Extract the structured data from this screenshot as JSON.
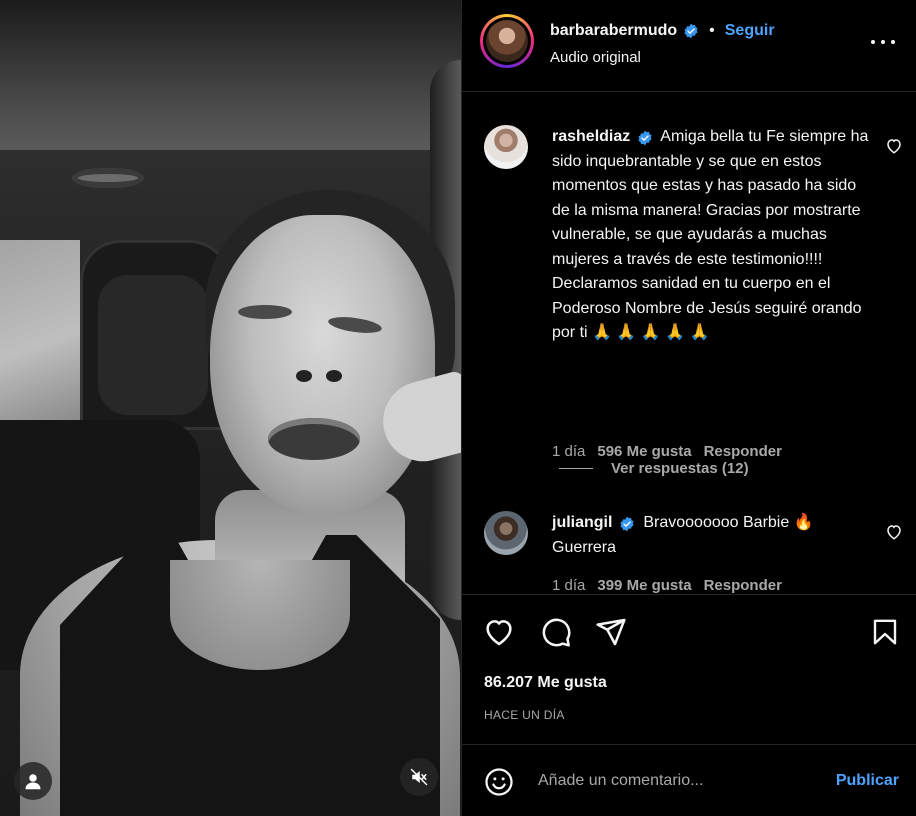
{
  "post": {
    "username": "barbarabermudo",
    "dot": "•",
    "follow_label": "Seguir",
    "subtitle": "Audio original",
    "likes_count": "86.207 Me gusta",
    "time_ago": "HACE UN DÍA",
    "verified": true
  },
  "comments": [
    {
      "username": "rasheldiaz",
      "verified": true,
      "text": "Amiga bella tu Fe siempre ha sido inquebrantable y se que en estos momentos que estas y has pasado ha sido de la misma manera! Gracias por mostrarte vulnerable, se que ayudarás a muchas mujeres a través de este testimonio!!!! Declaramos sanidad en tu cuerpo en el Poderoso Nombre de Jesús seguiré orando por ti 🙏 🙏 🙏 🙏 🙏",
      "time": "1 día",
      "likes": "596 Me gusta",
      "reply_label": "Responder",
      "view_replies": "Ver respuestas (12)"
    },
    {
      "username": "juliangil",
      "verified": true,
      "text": "Bravooooooo Barbie 🔥 Guerrera",
      "time": "1 día",
      "likes": "399 Me gusta",
      "reply_label": "Responder"
    }
  ],
  "add_comment": {
    "placeholder": "Añade un comentario...",
    "post_label": "Publicar"
  },
  "icons": {
    "more": "more-options-icon",
    "like": "heart-icon",
    "comment": "comment-icon",
    "share": "share-icon",
    "save": "bookmark-icon",
    "emoji": "emoji-icon",
    "tag": "user-tag-icon",
    "mute": "mute-icon"
  },
  "colors": {
    "accent": "#4ea3ff",
    "verified": "#3897f0",
    "muted_text": "#a8a8a8",
    "background": "#000000"
  }
}
